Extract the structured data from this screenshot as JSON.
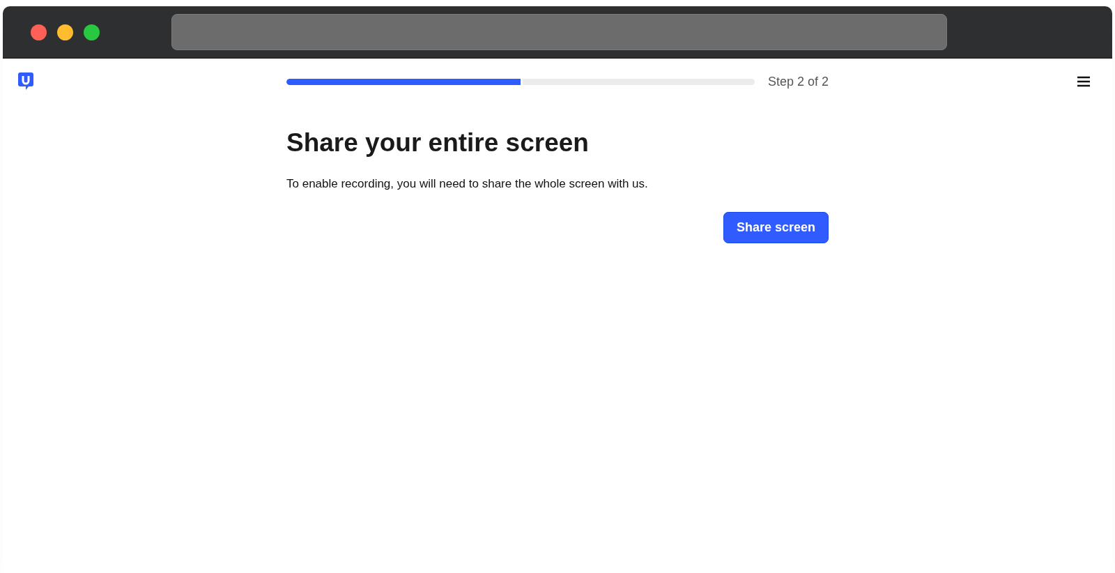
{
  "progress": {
    "level": 0.5,
    "label": "Step 2 of 2"
  },
  "heading": "Share your entire screen",
  "description": "To enable recording, you will need to share the whole screen with us.",
  "button": "Share screen"
}
